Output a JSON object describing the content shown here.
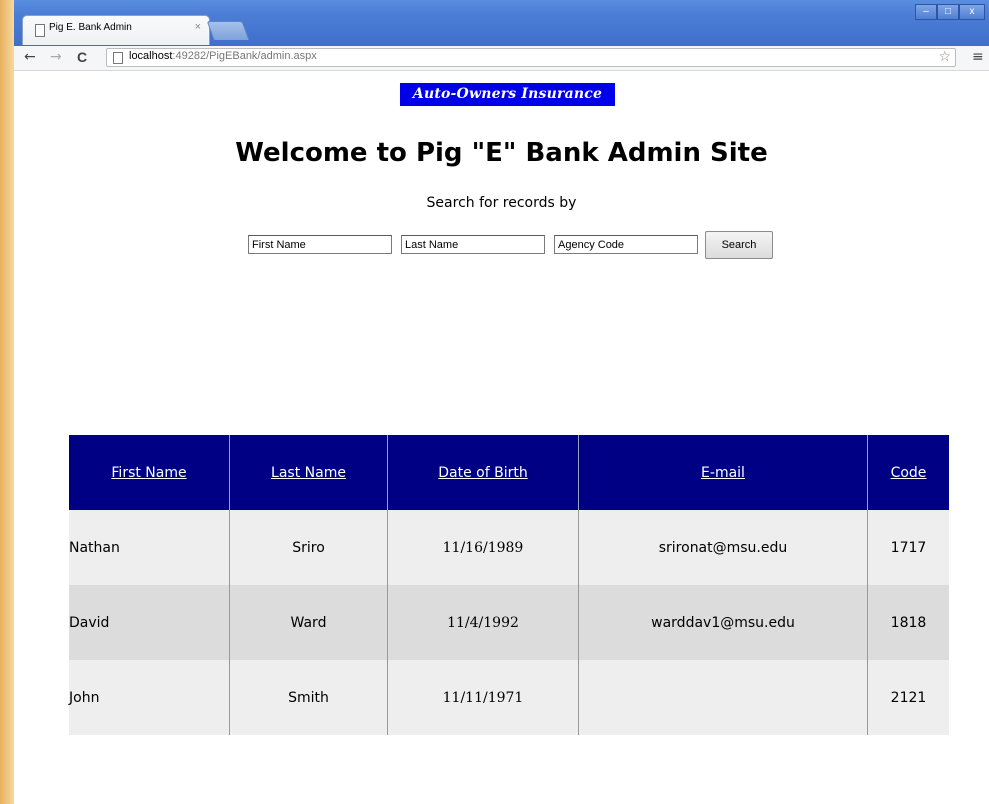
{
  "browser": {
    "tab_title": "Pig E. Bank Admin",
    "tab_close": "×",
    "url_host": "localhost",
    "url_rest": ":49282/PigEBank/admin.aspx",
    "window_controls": [
      "–",
      "□",
      "x"
    ]
  },
  "page": {
    "logo_text": "Auto-Owners Insurance",
    "title": "Welcome to Pig \"E\" Bank Admin Site",
    "subtitle": "Search for records by",
    "search": {
      "first_name_placeholder": "First Name",
      "last_name_placeholder": "Last Name",
      "agency_code_placeholder": "Agency Code",
      "button_label": "Search"
    }
  },
  "grid": {
    "columns": [
      "First Name",
      "Last Name",
      "Date of Birth",
      "E-mail",
      "Code"
    ],
    "rows": [
      {
        "first": "Nathan",
        "last": "Sriro",
        "dob": "11/16/1989",
        "email": "srironat@msu.edu",
        "code": "1717"
      },
      {
        "first": "David",
        "last": "Ward",
        "dob": "11/4/1992",
        "email": "warddav1@msu.edu",
        "code": "1818"
      },
      {
        "first": "John",
        "last": "Smith",
        "dob": "11/11/1971",
        "email": "",
        "code": "2121"
      }
    ],
    "header_color": "#000084"
  },
  "icons": {
    "back": "←",
    "forward": "→",
    "reload": "C",
    "star": "☆",
    "menu": "≡"
  }
}
